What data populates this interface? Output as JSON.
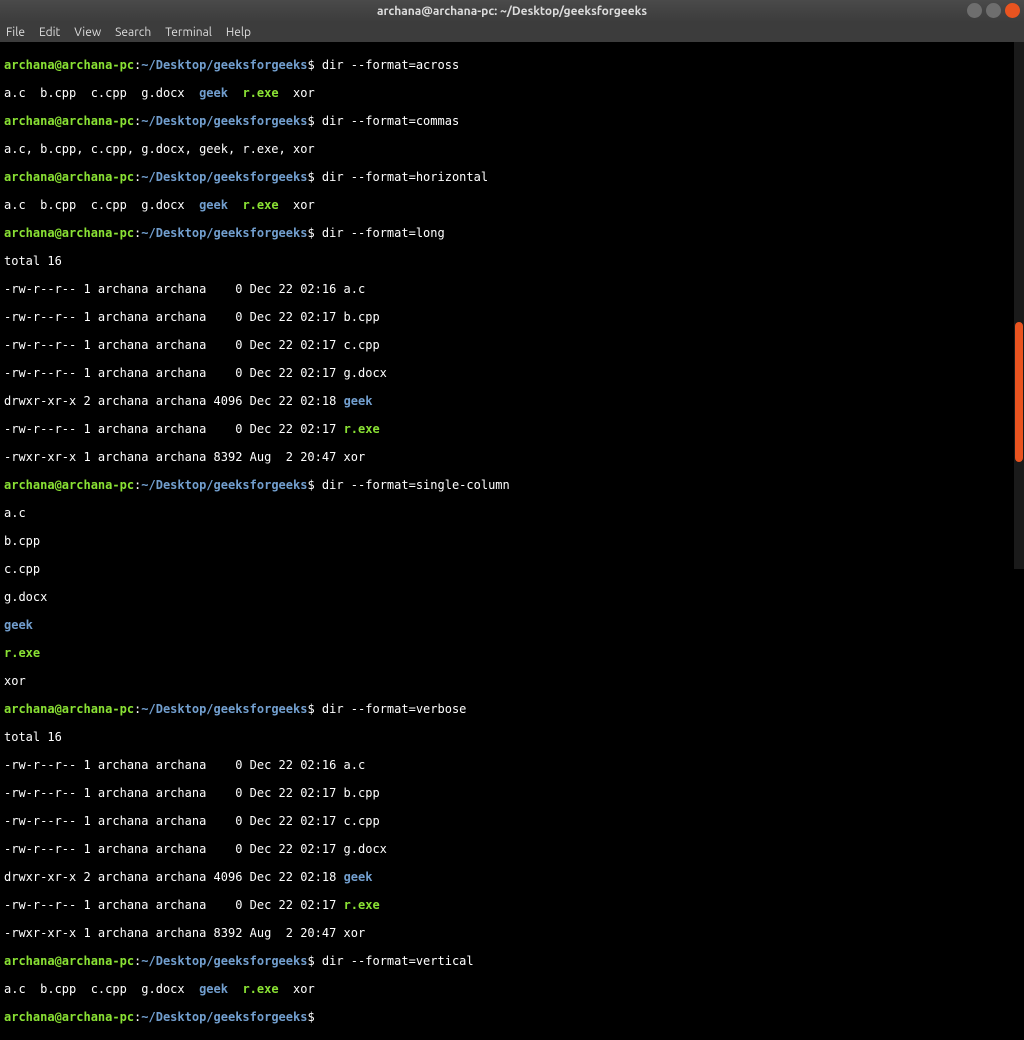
{
  "titlebar": {
    "title": "archana@archana-pc: ~/Desktop/geeksforgeeks"
  },
  "menu": {
    "file": "File",
    "edit": "Edit",
    "view": "View",
    "search": "Search",
    "terminal": "Terminal",
    "help": "Help"
  },
  "prompt": {
    "userhost": "archana@archana-pc",
    "colon": ":",
    "path": "~/Desktop/geeksforgeeks",
    "sigil": "$"
  },
  "cmds": {
    "across": " dir --format=across",
    "commas": " dir --format=commas",
    "horizontal": " dir --format=horizontal",
    "long": " dir --format=long",
    "single": " dir --format=single-column",
    "verbose": " dir --format=verbose",
    "vertical": " dir --format=vertical"
  },
  "outputs": {
    "across_pre1": "a.c  b.cpp  c.cpp  g.docx  ",
    "across_geek": "geek",
    "across_mid": "  ",
    "across_rexe": "r.exe",
    "across_post": "  xor",
    "commas_line": "a.c, b.cpp, c.cpp, g.docx, geek, r.exe, xor",
    "total": "total 16",
    "long_r1": "-rw-r--r-- 1 archana archana    0 Dec 22 02:16 a.c",
    "long_r2": "-rw-r--r-- 1 archana archana    0 Dec 22 02:17 b.cpp",
    "long_r3": "-rw-r--r-- 1 archana archana    0 Dec 22 02:17 c.cpp",
    "long_r4": "-rw-r--r-- 1 archana archana    0 Dec 22 02:17 g.docx",
    "long_r5_pre": "drwxr-xr-x 2 archana archana 4096 Dec 22 02:18 ",
    "long_r5_name": "geek",
    "long_r6_pre": "-rw-r--r-- 1 archana archana    0 Dec 22 02:17 ",
    "long_r6_name": "r.exe",
    "long_r7": "-rwxr-xr-x 1 archana archana 8392 Aug  2 20:47 xor",
    "single_ac": "a.c",
    "single_bcpp": "b.cpp",
    "single_ccpp": "c.cpp",
    "single_gdocx": "g.docx",
    "single_geek": "geek",
    "single_rexe": "r.exe",
    "single_xor": "xor"
  }
}
